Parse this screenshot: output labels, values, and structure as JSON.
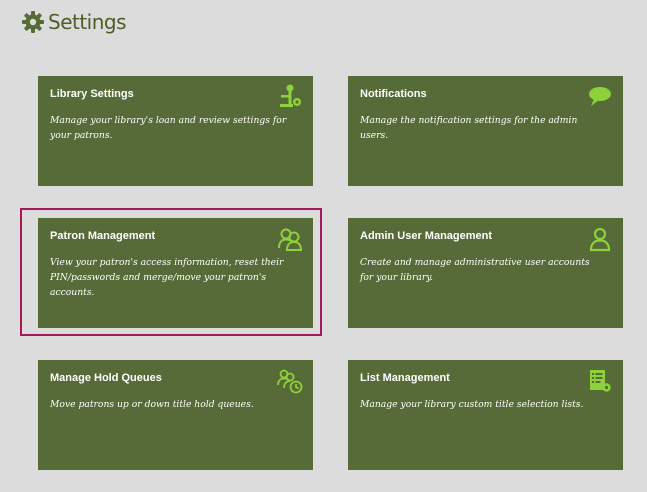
{
  "page": {
    "title": "Settings",
    "icon": "gear-icon"
  },
  "colors": {
    "background": "#dcdcdc",
    "tile": "#566b37",
    "icon": "#8fd13a",
    "header_text": "#4a5e2a",
    "selection": "#a31a5c"
  },
  "tiles": [
    {
      "title": "Library Settings",
      "description": "Manage your library's loan and review settings for your patrons.",
      "icon": "library-settings-icon"
    },
    {
      "title": "Notifications",
      "description": "Manage the notification settings for the admin users.",
      "icon": "chat-bubble-icon"
    },
    {
      "title": "Patron Management",
      "description": "View your patron's access information, reset their PIN/passwords and merge/move your patron's accounts.",
      "icon": "patrons-icon",
      "selected": true
    },
    {
      "title": "Admin User Management",
      "description": "Create and manage administrative user accounts for your library.",
      "icon": "admin-user-icon"
    },
    {
      "title": "Manage Hold Queues",
      "description": "Move patrons up or down title hold queues.",
      "icon": "hold-queue-icon"
    },
    {
      "title": "List Management",
      "description": "Manage your library custom title selection lists.",
      "icon": "list-settings-icon"
    }
  ]
}
